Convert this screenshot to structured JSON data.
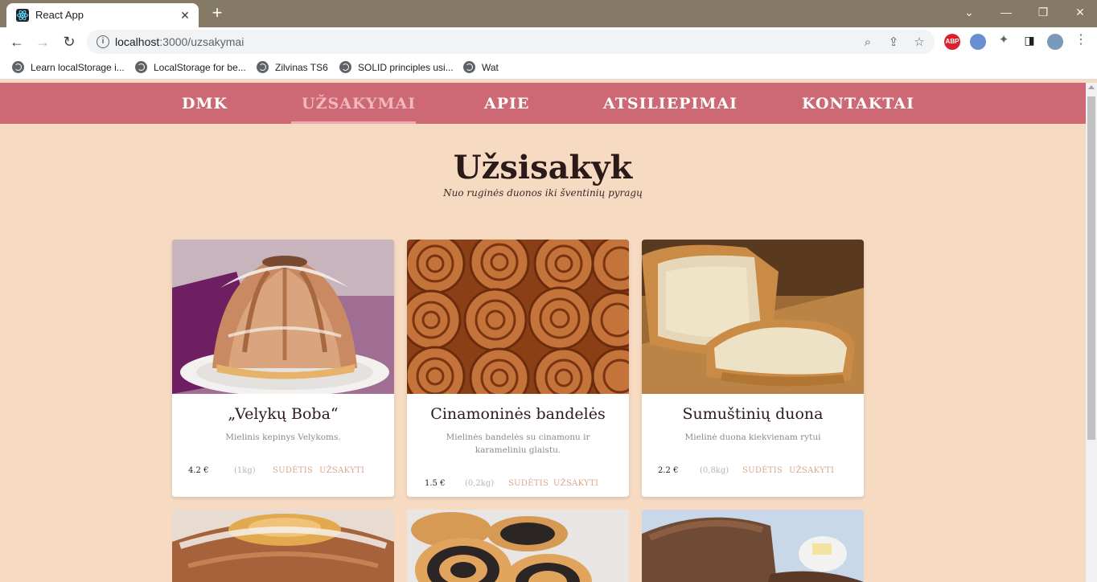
{
  "browser": {
    "tab_title": "React App",
    "tab_close": "✕",
    "new_tab": "+",
    "url_host": "localhost",
    "url_path": ":3000/uzsakymai",
    "window_controls": [
      "⌄",
      "—",
      "❐",
      "✕"
    ],
    "bookmarks": [
      "Learn localStorage i...",
      "LocalStorage for be...",
      "Zilvinas TS6",
      "SOLID principles usi...",
      "Wat"
    ],
    "extension_abp": "ABP"
  },
  "nav": {
    "items": [
      "DMK",
      "UŽSAKYMAI",
      "APIE",
      "ATSILIEPIMAI",
      "KONTAKTAI"
    ],
    "active": "UŽSAKYMAI"
  },
  "hero": {
    "title": "Užsisakyk",
    "subtitle": "Nuo ruginės duonos iki šventinių pyragų"
  },
  "products": [
    {
      "title": "„Velykų Boba“",
      "description": "Mielinis kepinys Velykoms.",
      "price": "4.2 €",
      "weight": "(1kg)",
      "ingredients_label": "SUDĖTIS",
      "order_label": "UŽSAKYTI"
    },
    {
      "title": "Cinamoninės bandelės",
      "description": "Mielinės bandelės su cinamonu ir karameliniu glaistu.",
      "price": "1.5 €",
      "weight": "(0,2kg)",
      "ingredients_label": "SUDĖTIS",
      "order_label": "UŽSAKYTI"
    },
    {
      "title": "Sumuštinių duona",
      "description": "Mielinė duona kiekvienam rytui",
      "price": "2.2 €",
      "weight": "(0,8kg)",
      "ingredients_label": "SUDĖTIS",
      "order_label": "UŽSAKYTI"
    }
  ],
  "colors": {
    "nav_bg": "#cc6975",
    "page_bg": "#f7dac2",
    "button_text": "#d7a58c"
  }
}
